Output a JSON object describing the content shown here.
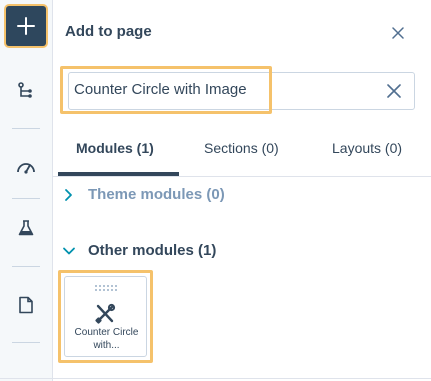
{
  "panel": {
    "title": "Add to page",
    "close_icon": "close-icon"
  },
  "rail": {
    "items": [
      {
        "name": "add",
        "icon": "plus-icon",
        "active": true
      },
      {
        "name": "structure",
        "icon": "tree-icon"
      },
      {
        "name": "optimize",
        "icon": "gauge-icon"
      },
      {
        "name": "test",
        "icon": "flask-icon"
      },
      {
        "name": "page",
        "icon": "document-icon"
      }
    ]
  },
  "search": {
    "value": "Counter Circle with Image",
    "clear_icon": "clear-icon"
  },
  "tabs": [
    {
      "label": "Modules (1)",
      "active": true
    },
    {
      "label": "Sections (0)",
      "active": false
    },
    {
      "label": "Layouts (0)",
      "active": false
    }
  ],
  "sections": [
    {
      "label": "Theme modules (0)",
      "expanded": false
    },
    {
      "label": "Other modules (1)",
      "expanded": true
    }
  ],
  "modules": [
    {
      "label": "Counter Circle with...",
      "icon": "tools-icon"
    }
  ],
  "colors": {
    "highlight": "#f5c26b",
    "primary_dark": "#2e475d",
    "text": "#33475b",
    "muted": "#7c98b6"
  }
}
